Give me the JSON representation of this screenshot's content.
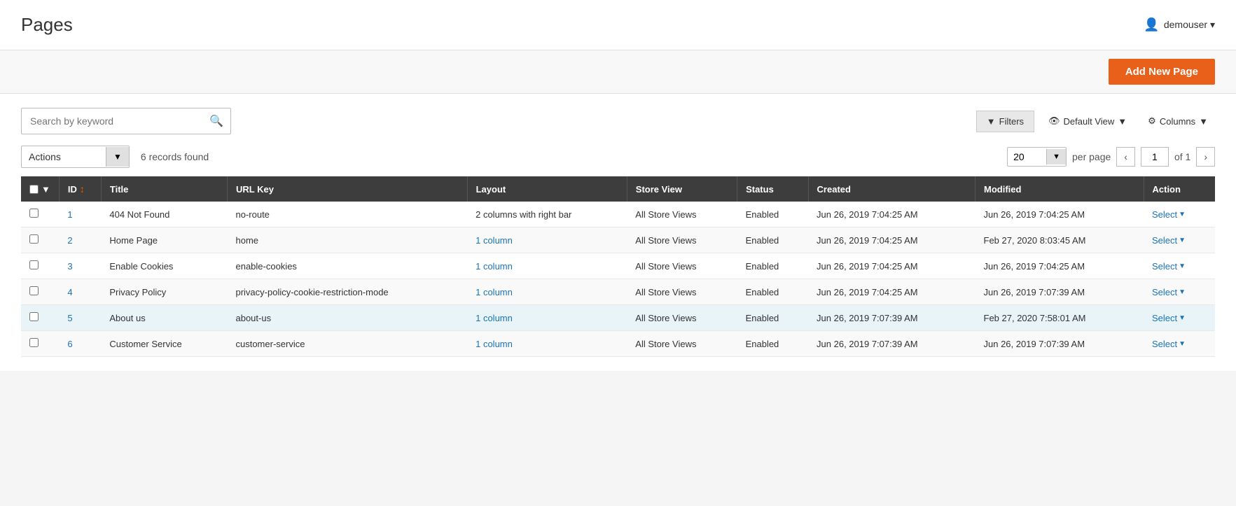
{
  "header": {
    "title": "Pages",
    "user": "demouser",
    "user_dropdown_label": "demouser ▾"
  },
  "toolbar": {
    "add_button_label": "Add New Page"
  },
  "search": {
    "placeholder": "Search by keyword"
  },
  "filters": {
    "filters_label": "Filters",
    "default_view_label": "Default View",
    "columns_label": "Columns"
  },
  "actions": {
    "label": "Actions",
    "records_found": "6 records found"
  },
  "pagination": {
    "per_page": "20",
    "current_page": "1",
    "total_pages": "1",
    "per_page_label": "per page",
    "of_label": "of"
  },
  "table": {
    "columns": [
      "",
      "ID",
      "Title",
      "URL Key",
      "Layout",
      "Store View",
      "Status",
      "Created",
      "Modified",
      "Action"
    ],
    "rows": [
      {
        "id": "1",
        "title": "404 Not Found",
        "url_key": "no-route",
        "layout": "2 columns with right bar",
        "store_view": "All Store Views",
        "status": "Enabled",
        "created": "Jun 26, 2019 7:04:25 AM",
        "modified": "Jun 26, 2019 7:04:25 AM",
        "action": "Select"
      },
      {
        "id": "2",
        "title": "Home Page",
        "url_key": "home",
        "layout": "1 column",
        "store_view": "All Store Views",
        "status": "Enabled",
        "created": "Jun 26, 2019 7:04:25 AM",
        "modified": "Feb 27, 2020 8:03:45 AM",
        "action": "Select"
      },
      {
        "id": "3",
        "title": "Enable Cookies",
        "url_key": "enable-cookies",
        "layout": "1 column",
        "store_view": "All Store Views",
        "status": "Enabled",
        "created": "Jun 26, 2019 7:04:25 AM",
        "modified": "Jun 26, 2019 7:04:25 AM",
        "action": "Select"
      },
      {
        "id": "4",
        "title": "Privacy Policy",
        "url_key": "privacy-policy-cookie-restriction-mode",
        "layout": "1 column",
        "store_view": "All Store Views",
        "status": "Enabled",
        "created": "Jun 26, 2019 7:04:25 AM",
        "modified": "Jun 26, 2019 7:07:39 AM",
        "action": "Select"
      },
      {
        "id": "5",
        "title": "About us",
        "url_key": "about-us",
        "layout": "1 column",
        "store_view": "All Store Views",
        "status": "Enabled",
        "created": "Jun 26, 2019 7:07:39 AM",
        "modified": "Feb 27, 2020 7:58:01 AM",
        "action": "Select"
      },
      {
        "id": "6",
        "title": "Customer Service",
        "url_key": "customer-service",
        "layout": "1 column",
        "store_view": "All Store Views",
        "status": "Enabled",
        "created": "Jun 26, 2019 7:07:39 AM",
        "modified": "Jun 26, 2019 7:07:39 AM",
        "action": "Select"
      }
    ]
  }
}
